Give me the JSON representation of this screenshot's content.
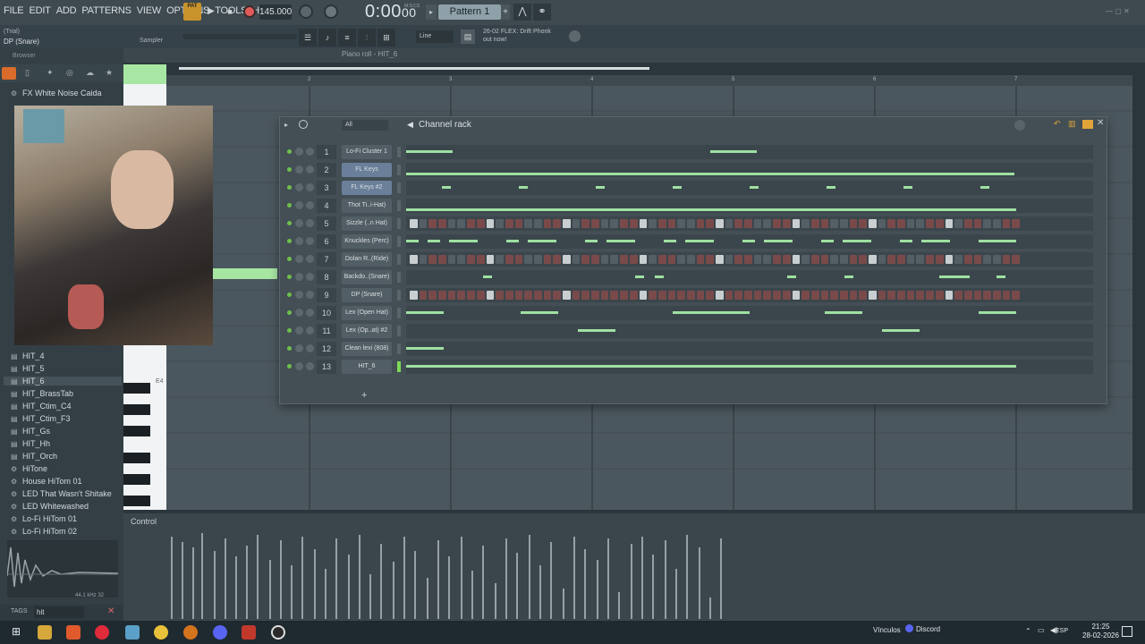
{
  "menu": [
    "FILE",
    "EDIT",
    "ADD",
    "PATTERNS",
    "VIEW",
    "OPTIONS",
    "TOOLS",
    "HELP"
  ],
  "transport": {
    "pat_badge": "PAT",
    "tempo": "145.000",
    "time": "0:00",
    "time_sub": "00",
    "time_unit": "M:S:CS",
    "pattern": "Pattern 1"
  },
  "hint": {
    "title": "(Trial)",
    "name": "DP (Snare)",
    "sampler": "Sampler"
  },
  "snap": "Line",
  "news": {
    "line1": "26-02  FLEX: Drift Phonk",
    "line2": "out now!"
  },
  "browser": {
    "header": "Browser",
    "items_top": [
      "FX White Noise Caida"
    ],
    "items": [
      "HIT_4",
      "HIT_5",
      "HIT_6",
      "HIT_BrassTab",
      "HIT_Ctim_C4",
      "HIT_Ctim_F3",
      "HIT_Gs",
      "HIT_Hh",
      "HIT_Orch",
      "HiTone",
      "House HiTom 01",
      "LED That Wasn't Shitake",
      "LED Whitewashed",
      "Lo-Fi HiTom 01",
      "Lo-Fi HiTom 02"
    ],
    "selected": "HIT_6",
    "sample_info": "44.1 kHz 32",
    "tags_label": "TAGS",
    "search": "hit"
  },
  "piano_roll": {
    "title": "Piano roll - HIT_6",
    "ruler": [
      "2",
      "3",
      "4",
      "5",
      "6",
      "7"
    ],
    "key_label": "E4",
    "control_label": "Control"
  },
  "rack": {
    "title": "Channel rack",
    "filter": "All",
    "channels": [
      {
        "num": "1",
        "name": "Lo-Fi Cluster 1",
        "type": "roll"
      },
      {
        "num": "2",
        "name": "FL Keys",
        "type": "roll",
        "selected": true
      },
      {
        "num": "3",
        "name": "FL Keys #2",
        "type": "roll",
        "selected": true
      },
      {
        "num": "4",
        "name": "Thot Ti..i-Hat)",
        "type": "roll"
      },
      {
        "num": "5",
        "name": "Sizzle (..n Hat)",
        "type": "steps"
      },
      {
        "num": "6",
        "name": "Knuckles (Perc)",
        "type": "roll"
      },
      {
        "num": "7",
        "name": "Dolan R..(Ride)",
        "type": "steps"
      },
      {
        "num": "8",
        "name": "Backdo..(Snare)",
        "type": "roll"
      },
      {
        "num": "9",
        "name": "DP (Snare)",
        "type": "steps"
      },
      {
        "num": "10",
        "name": "Lex (Open Hat)",
        "type": "roll"
      },
      {
        "num": "11",
        "name": "Lex (Op..at) #2",
        "type": "roll"
      },
      {
        "num": "12",
        "name": "Clean lexi (808)",
        "type": "roll"
      },
      {
        "num": "13",
        "name": "HIT_6",
        "type": "roll"
      }
    ],
    "add": "+"
  },
  "taskbar": {
    "vinculos": "Vínculos",
    "discord": "Discord",
    "lang": "ESP",
    "time": "21:25",
    "date": "28-02-2026"
  }
}
